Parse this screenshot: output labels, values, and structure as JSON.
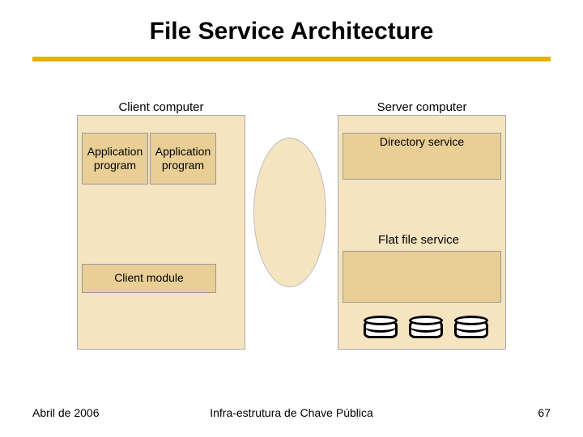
{
  "title": "File Service Architecture",
  "client": {
    "label": "Client computer"
  },
  "server": {
    "label": "Server computer"
  },
  "boxes": {
    "app1_line1": "Application",
    "app1_line2": "program",
    "app2_line1": "Application",
    "app2_line2": "program",
    "client_module": "Client module",
    "directory_service": "Directory service",
    "flat_file_service": "Flat file service"
  },
  "footer": {
    "date": "Abril de 2006",
    "center": "Infra-estrutura de Chave Pública",
    "page": "67"
  }
}
